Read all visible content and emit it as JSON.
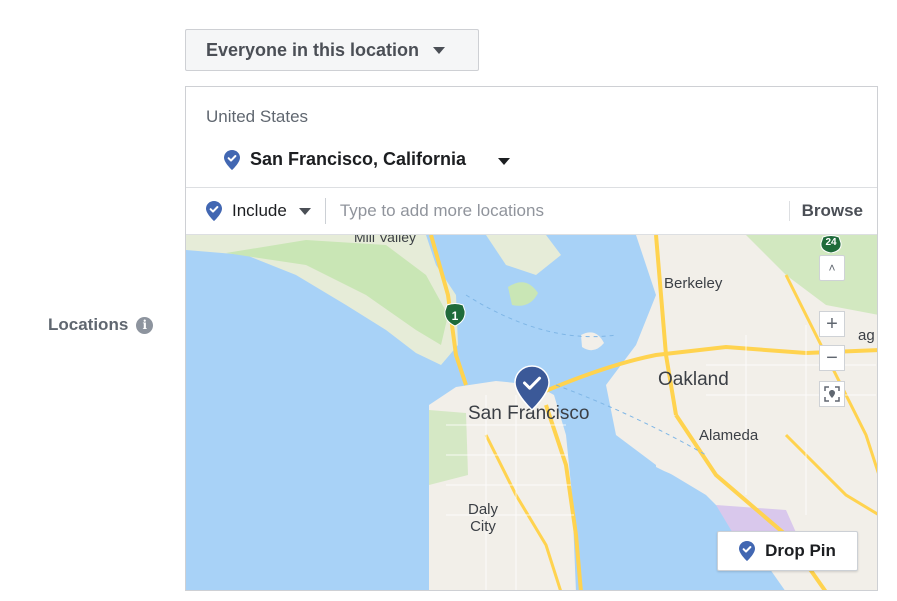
{
  "audience": {
    "label": "Everyone in this location"
  },
  "locations": {
    "label": "Locations",
    "info_icon": "i"
  },
  "selection": {
    "country": "United States",
    "city": "San Francisco, California"
  },
  "search": {
    "mode": "Include",
    "placeholder": "Type to add more locations",
    "browse_label": "Browse"
  },
  "map": {
    "labels": {
      "san_francisco": "San Francisco",
      "oakland": "Oakland",
      "berkeley": "Berkeley",
      "alameda": "Alameda",
      "daly_line1": "Daly",
      "daly_line2": "City",
      "mill_valley": "Mill Valley",
      "edge_fragment": "ag"
    },
    "highway_1": "1",
    "highway_24": "24",
    "zoom": {
      "up": "˄",
      "in": "+",
      "out": "−"
    },
    "drop_pin_label": "Drop Pin"
  },
  "colors": {
    "brand_pin": "#4267b2",
    "water": "#a8d2f7",
    "land": "#f2efe9",
    "park": "#c9e6b5",
    "road": "#ffe07a",
    "highway_shield": "#1f6b3a"
  }
}
